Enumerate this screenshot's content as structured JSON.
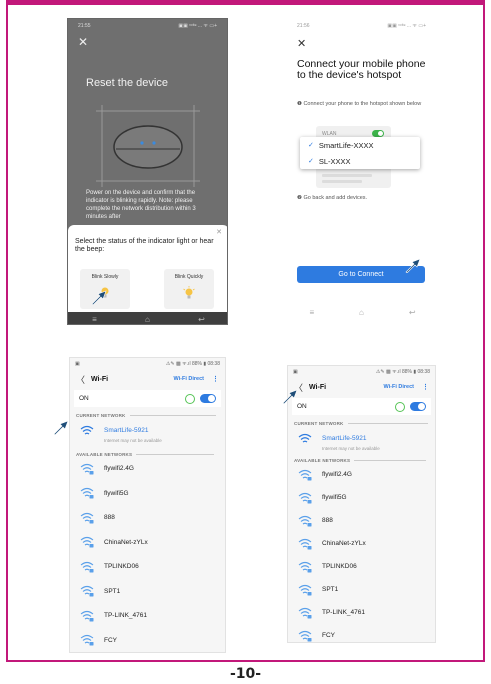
{
  "page": {
    "number": "-10-",
    "accent_color": "#c2187a"
  },
  "reset_screen": {
    "time": "21:55",
    "status_icons": "▣▣ ᵛᵒˡᵗᵉ ... ᯤ ▭+",
    "close_icon": "close-icon",
    "title": "Reset the device",
    "description": "Power on the device and confirm that the indicator is blinking rapidly. Note: please complete the network distribution within 3 minutes after",
    "sheet": {
      "question": "Select the status of the indicator light or hear the beep:",
      "options": [
        "Blink Slowly",
        "Blink Quickly"
      ]
    }
  },
  "hotspot_screen": {
    "time": "21:56",
    "status_icons": "▣▣ ᵛᵒˡᵗᵉ ... ᯤ ▭+",
    "title": "Connect your mobile phone to the device's hotspot",
    "instruction": "❶ Connect your phone to the hotspot shown below",
    "wlan_label": "WLAN",
    "networks": [
      "SmartLife-XXXX",
      "SL-XXXX"
    ],
    "back_instruction": "❷ Go back and add devices.",
    "button": "Go to Connect"
  },
  "wifi_screen": {
    "status_left": "▣",
    "status_right": "⚠✎ ▩ ᯤ.ıl 88% ▮ 08:38",
    "title": "Wi-Fi",
    "wifi_direct": "Wi-Fi Direct",
    "more": "⋮",
    "on_label": "ON",
    "current_label": "CURRENT NETWORK",
    "current_network": {
      "name": "SmartLife-5921",
      "sub": "Internet may not be available"
    },
    "available_label": "AVAILABLE NETWORKS",
    "available": [
      "flywifi2.4G",
      "flywifi5G",
      "888",
      "ChinaNet-zYLx",
      "TPLINKD06",
      "SPT1",
      "TP-LINK_4761",
      "FCY"
    ]
  }
}
